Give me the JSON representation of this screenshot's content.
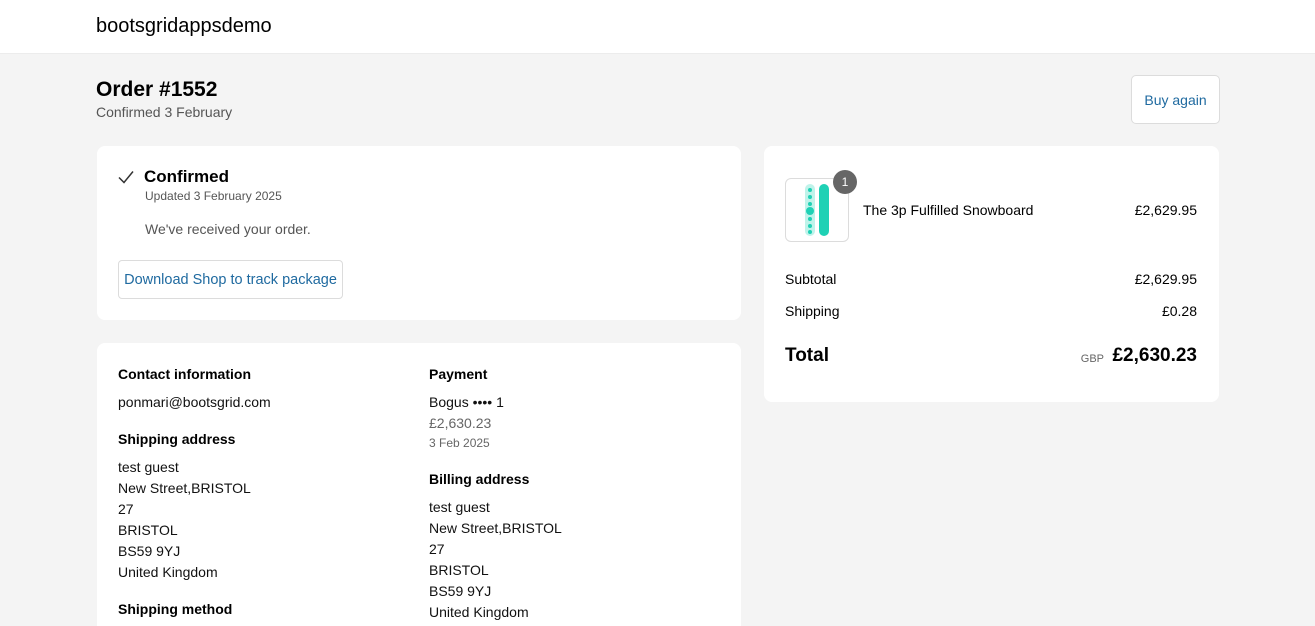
{
  "header": {
    "brand": "bootsgridappsdemo"
  },
  "order": {
    "title": "Order #1552",
    "subtitle": "Confirmed 3 February",
    "buy_again_label": "Buy again"
  },
  "status": {
    "icon": "check-icon",
    "title": "Confirmed",
    "updated": "Updated 3 February 2025",
    "message": "We've received your order.",
    "track_button_label": "Download Shop to track package"
  },
  "details": {
    "contact": {
      "title": "Contact information",
      "email": "ponmari@bootsgrid.com"
    },
    "shipping_address": {
      "title": "Shipping address",
      "lines": [
        "test guest",
        "New Street,BRISTOL",
        "27",
        "BRISTOL",
        "BS59 9YJ",
        "United Kingdom"
      ]
    },
    "shipping_method": {
      "title": "Shipping method"
    },
    "payment": {
      "title": "Payment",
      "method": "Bogus •••• 1",
      "amount": "£2,630.23",
      "date": "3 Feb 2025"
    },
    "billing_address": {
      "title": "Billing address",
      "lines": [
        "test guest",
        "New Street,BRISTOL",
        "27",
        "BRISTOL",
        "BS59 9YJ",
        "United Kingdom"
      ]
    }
  },
  "summary": {
    "item": {
      "name": "The 3p Fulfilled Snowboard",
      "price": "£2,629.95",
      "quantity": "1",
      "image_icon": "snowboard-image"
    },
    "subtotal_label": "Subtotal",
    "subtotal_value": "£2,629.95",
    "shipping_label": "Shipping",
    "shipping_value": "£0.28",
    "total_label": "Total",
    "total_currency": "GBP",
    "total_value": "£2,630.23"
  },
  "colors": {
    "link": "#1f6aa0",
    "background": "#f4f4f4",
    "badge": "#666666",
    "snowboard": "#1fd1b5"
  }
}
